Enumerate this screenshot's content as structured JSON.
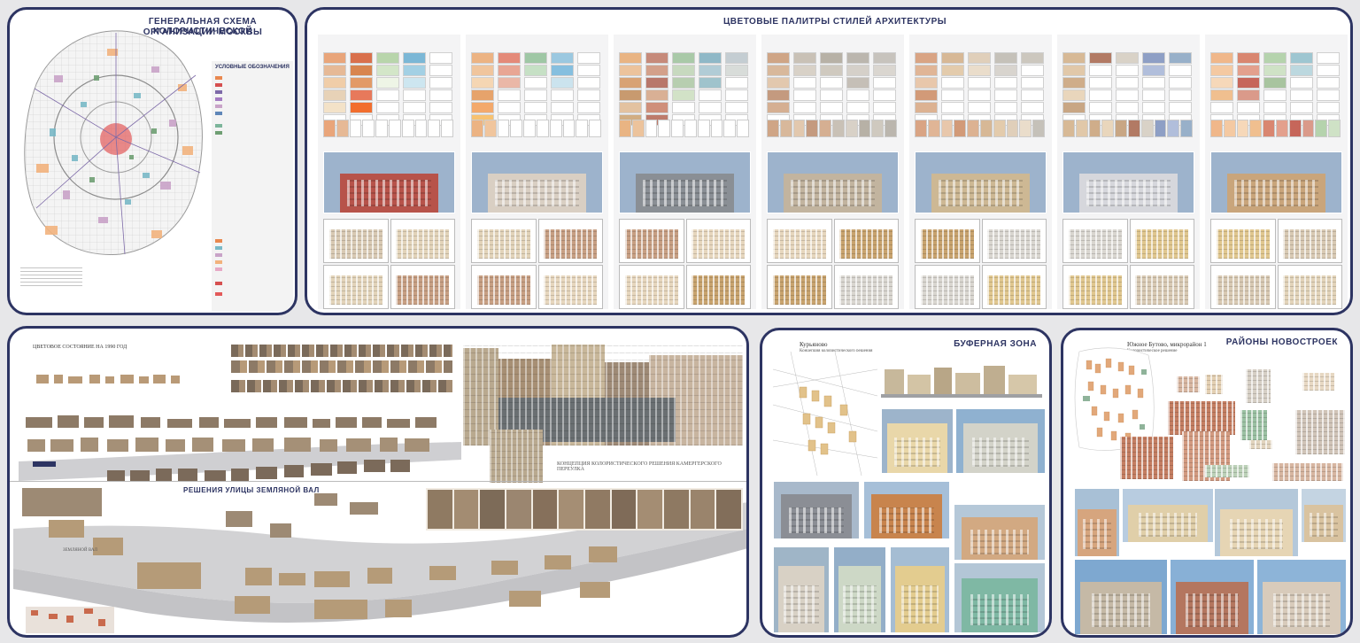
{
  "map_panel": {
    "title_line1": "ГЕНЕРАЛЬНАЯ СХЕМА КОЛОРИСТИЧЕСКОЙ",
    "title_line2": "ОРГАНИЗАЦИИ МОСКВЫ",
    "legend_heading": "УСЛОВНЫЕ ОБОЗНАЧЕНИЯ"
  },
  "palettes_panel": {
    "title": "ЦВЕТОВЫЕ ПАЛИТРЫ СТИЛЕЙ АРХИТЕКТУРЫ"
  },
  "street_panel": {
    "heading1": "ЦВЕТОВОЕ СОСТОЯНИЕ НА 1990 ГОД",
    "heading2": "РЕШЕНИЯ УЛИЦЫ ЗЕМЛЯНОЙ ВАЛ",
    "caption": "КОНЦЕПЦИЯ КОЛОРИСТИЧЕСКОГО РЕШЕНИЯ КАМЕРГЕРСКОГО ПЕРЕУЛКА",
    "road_label": "ЗЕМЛЯНОЙ ВАЛ"
  },
  "buffer_panel": {
    "title": "БУФЕРНАЯ ЗОНА",
    "location": "Курьяново",
    "subtitle": "Концепция колористического решения"
  },
  "new_districts_panel": {
    "title": "РАЙОНЫ НОВОСТРОЕК",
    "location": "Южное Бутово, микрорайон 1",
    "subtitle": "Колористическое решение"
  },
  "colors": {
    "frame": "#2d3462",
    "accent_green": "#7cb59a",
    "accent_orange": "#e9884f"
  }
}
